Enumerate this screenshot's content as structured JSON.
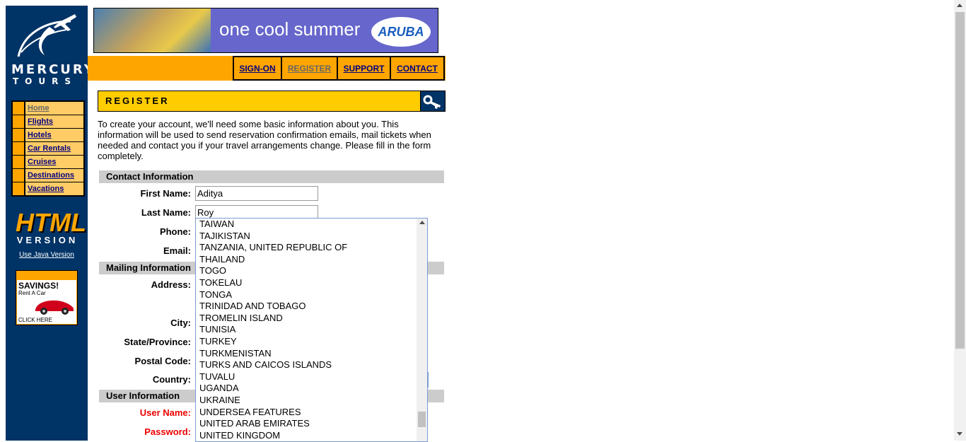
{
  "brand": {
    "line1": "MERCURY",
    "line2": "TOURS"
  },
  "side_nav": [
    {
      "label": "Home"
    },
    {
      "label": "Flights"
    },
    {
      "label": "Hotels"
    },
    {
      "label": "Car Rentals"
    },
    {
      "label": "Cruises"
    },
    {
      "label": "Destinations"
    },
    {
      "label": "Vacations"
    }
  ],
  "html_version": {
    "big": "HTML",
    "small": "VERSION",
    "java_link": "Use Java Version"
  },
  "ad": {
    "savings": "SAVINGS!",
    "rent": "Rent A Car",
    "click": "CLICK HERE"
  },
  "banner": {
    "tagline": "one cool summer",
    "logo": "ARUBA"
  },
  "top_nav": [
    {
      "label": "SIGN-ON"
    },
    {
      "label": "REGISTER"
    },
    {
      "label": "SUPPORT"
    },
    {
      "label": "CONTACT"
    }
  ],
  "register": {
    "title": "REGISTER",
    "intro": "To create your account, we'll need some basic information about you. This information will be used to send reservation confirmation emails, mail tickets when needed and contact you if your travel arrangements change. Please fill in the form completely."
  },
  "sections": {
    "contact": "Contact Information",
    "mailing": "Mailing Information",
    "user": "User Information"
  },
  "labels": {
    "first_name": "First Name:",
    "last_name": "Last Name:",
    "phone": "Phone:",
    "email": "Email:",
    "address": "Address:",
    "city": "City:",
    "state": "State/Province:",
    "postal": "Postal Code:",
    "country": "Country:",
    "username": "User Name:",
    "password": "Password:"
  },
  "values": {
    "first_name": "Aditya",
    "last_name": "Roy"
  },
  "country_options": [
    "TAIWAN",
    "TAJIKISTAN",
    "TANZANIA, UNITED REPUBLIC OF",
    "THAILAND",
    "TOGO",
    "TOKELAU",
    "TONGA",
    "TRINIDAD AND TOBAGO",
    "TROMELIN ISLAND",
    "TUNISIA",
    "TURKEY",
    "TURKMENISTAN",
    "TURKS AND CAICOS ISLANDS",
    "TUVALU",
    "UGANDA",
    "UKRAINE",
    "UNDERSEA FEATURES",
    "UNITED ARAB EMIRATES",
    "UNITED KINGDOM"
  ],
  "colors": {
    "navy": "#003366",
    "orange": "#FFA500",
    "yellow": "#FFCC00",
    "label_red": "#e00"
  },
  "icons": {
    "logo": "plane-logo-icon",
    "key": "key-icon",
    "car": "car-icon"
  }
}
